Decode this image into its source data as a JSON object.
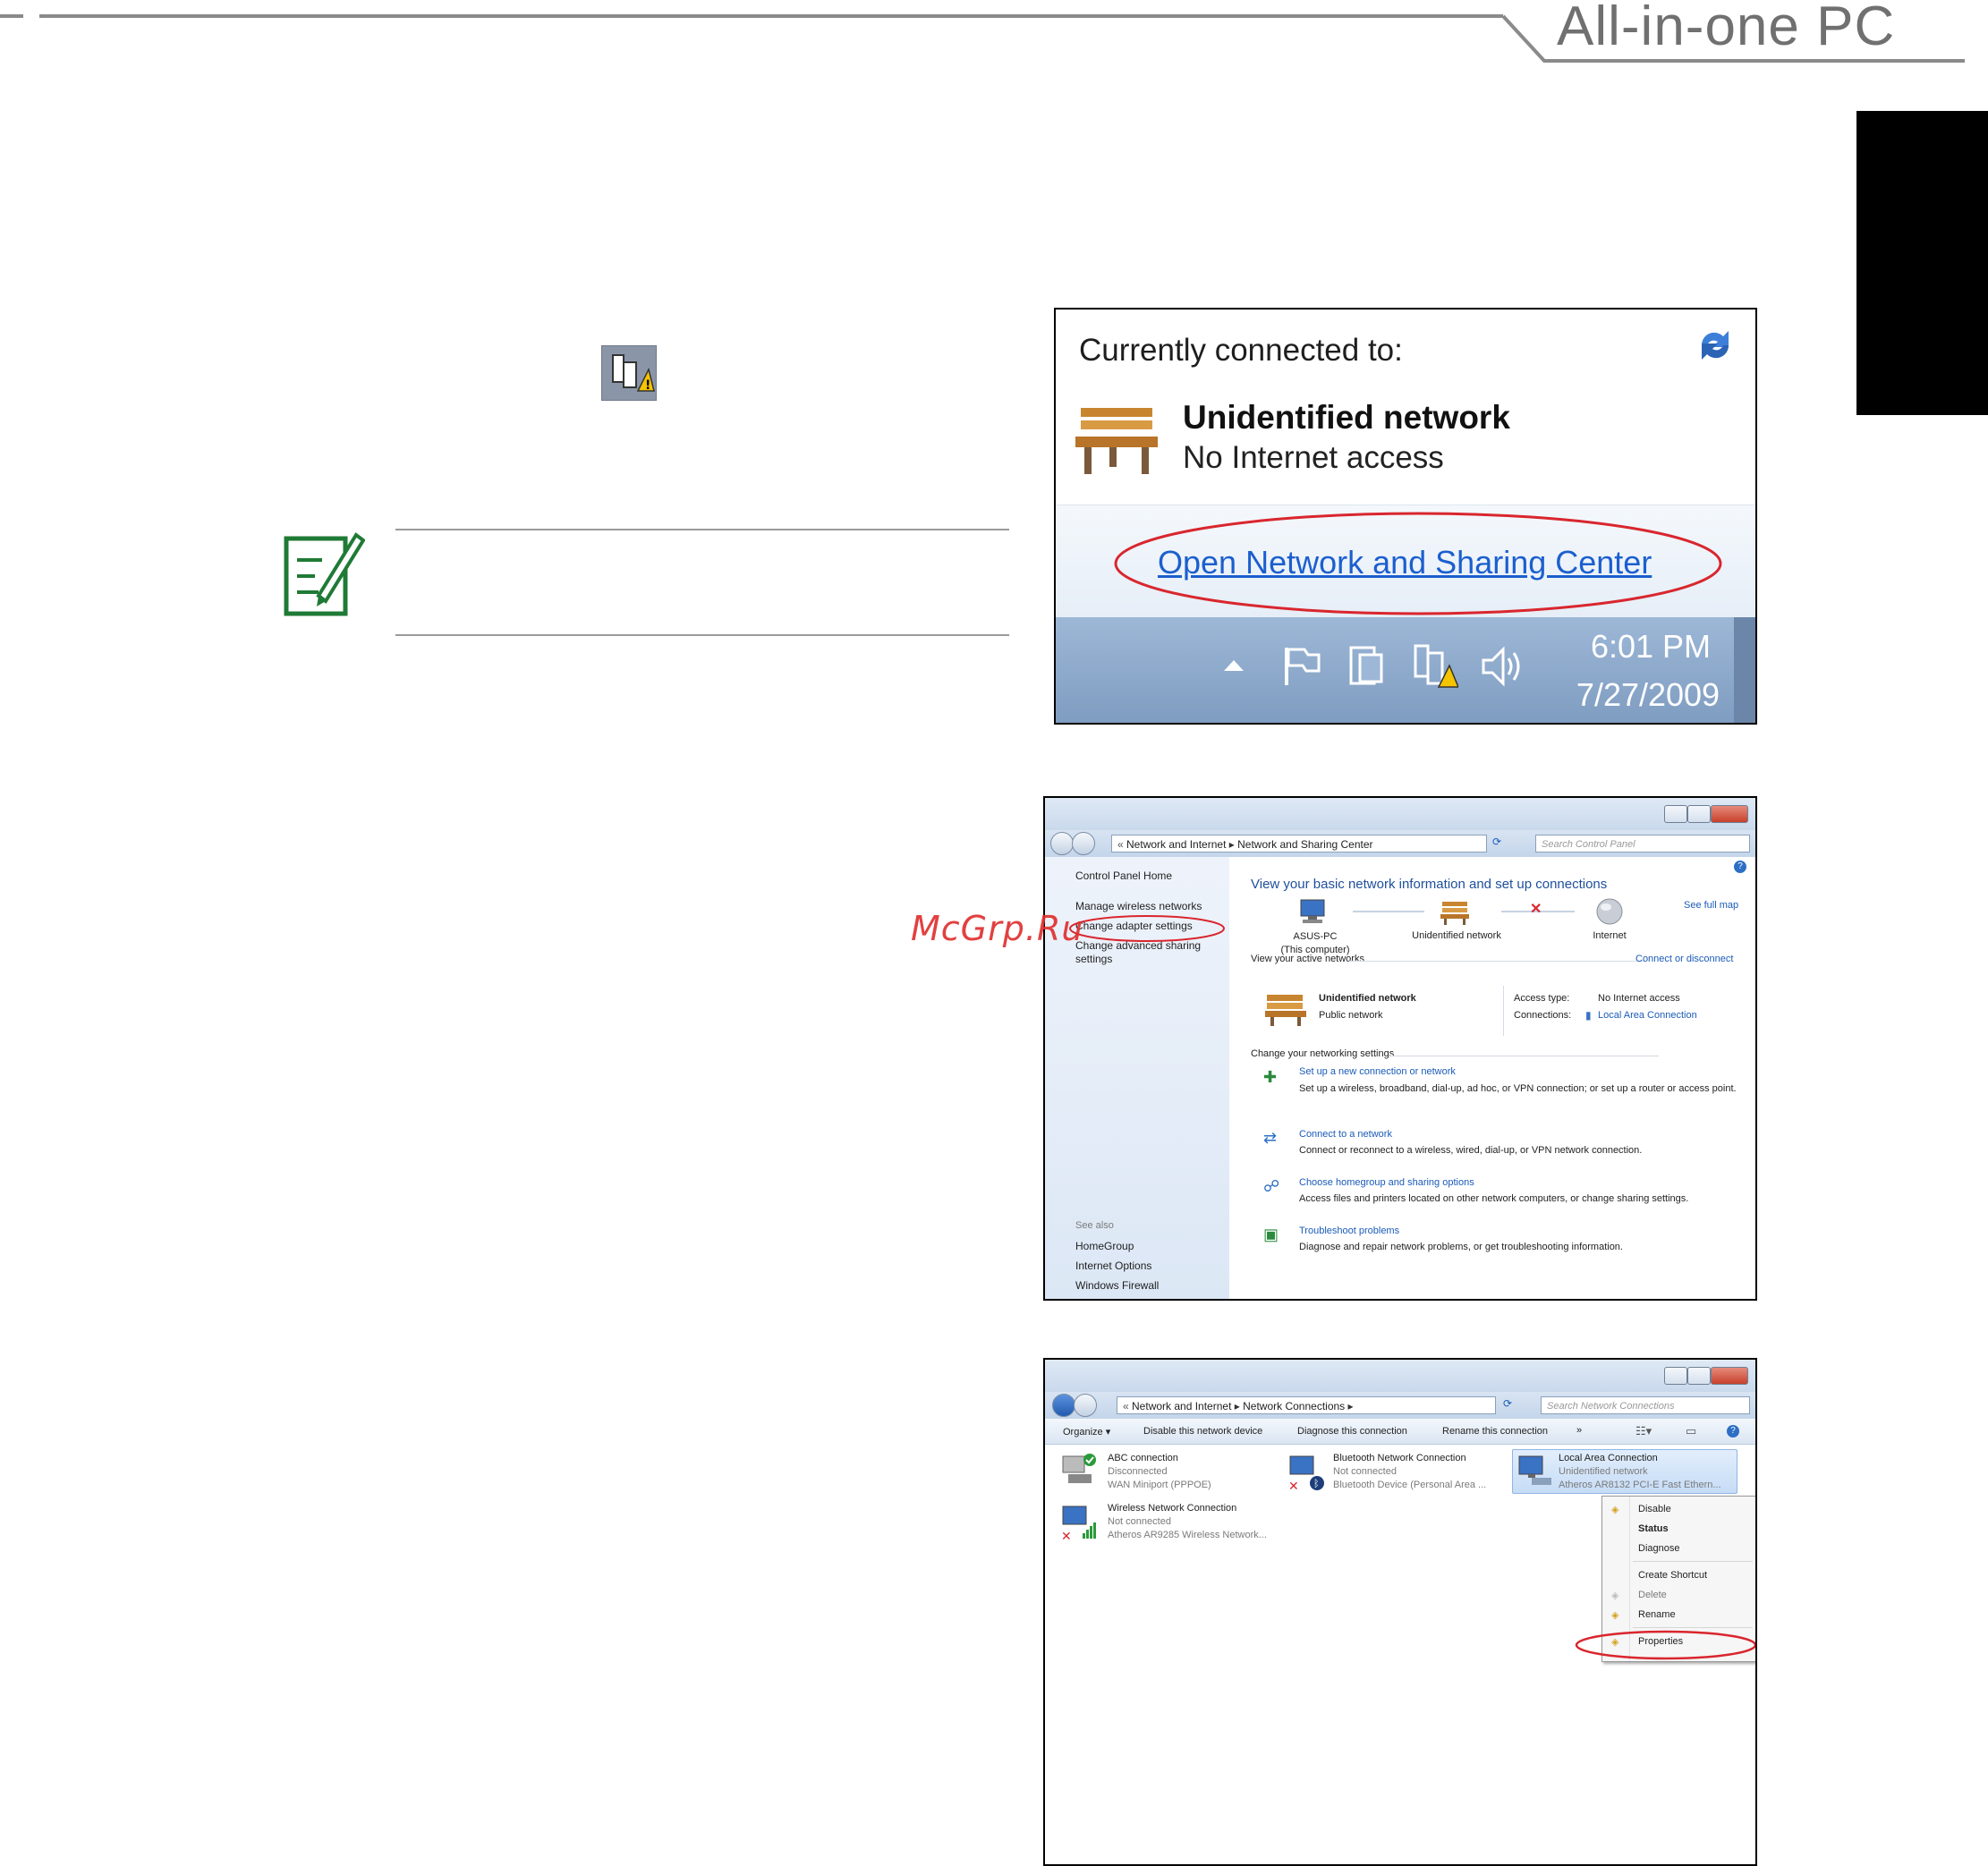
{
  "header": {
    "title": "All-in-one PC"
  },
  "popup": {
    "title": "Currently connected to:",
    "network_name": "Unidentified network",
    "network_status": "No Internet access",
    "link": "Open Network and Sharing Center",
    "time": "6:01 PM",
    "date": "7/27/2009"
  },
  "nsc": {
    "breadcrumb": [
      "Network and Internet",
      "Network and Sharing Center"
    ],
    "search_placeholder": "Search Control Panel",
    "sidebar": {
      "home": "Control Panel Home",
      "items": [
        "Manage wireless networks",
        "Change adapter settings",
        "Change advanced sharing settings"
      ],
      "see_also_label": "See also",
      "see_also": [
        "HomeGroup",
        "Internet Options",
        "Windows Firewall"
      ]
    },
    "main_title": "View your basic network information and set up connections",
    "see_full_map": "See full map",
    "map": {
      "computer": "ASUS-PC",
      "computer_sub": "(This computer)",
      "network": "Unidentified network",
      "internet": "Internet"
    },
    "active_label": "View your active networks",
    "connect_disconnect": "Connect or disconnect",
    "active": {
      "name": "Unidentified network",
      "type": "Public network",
      "access_label": "Access type:",
      "access_value": "No Internet access",
      "conn_label": "Connections:",
      "conn_value": "Local Area Connection"
    },
    "change_label": "Change your networking settings",
    "tasks": [
      {
        "title": "Set up a new connection or network",
        "desc": "Set up a wireless, broadband, dial-up, ad hoc, or VPN connection; or set up a router or access point."
      },
      {
        "title": "Connect to a network",
        "desc": "Connect or reconnect to a wireless, wired, dial-up, or VPN network connection."
      },
      {
        "title": "Choose homegroup and sharing options",
        "desc": "Access files and printers located on other network computers, or change sharing settings."
      },
      {
        "title": "Troubleshoot problems",
        "desc": "Diagnose and repair network problems, or get troubleshooting information."
      }
    ]
  },
  "ncw": {
    "breadcrumb": [
      "Network and Internet",
      "Network Connections"
    ],
    "search_placeholder": "Search Network Connections",
    "toolbar": [
      "Organize ▾",
      "Disable this network device",
      "Diagnose this connection",
      "Rename this connection",
      "»"
    ],
    "connections": [
      {
        "name": "ABC connection",
        "status": "Disconnected",
        "device": "WAN Miniport (PPPOE)"
      },
      {
        "name": "Bluetooth Network Connection",
        "status": "Not connected",
        "device": "Bluetooth Device (Personal Area ..."
      },
      {
        "name": "Local Area Connection",
        "status": "Unidentified network",
        "device": "Atheros AR8132 PCI-E Fast Ethern..."
      },
      {
        "name": "Wireless Network Connection",
        "status": "Not connected",
        "device": "Atheros AR9285 Wireless Network..."
      }
    ],
    "menu": [
      "Disable",
      "Status",
      "Diagnose",
      "Create Shortcut",
      "Delete",
      "Rename",
      "Properties"
    ]
  },
  "watermark": "McGrp.Ru",
  "colors": {
    "accent_red": "#d9262e",
    "link_blue": "#1a5bb8",
    "note_green": "#1f7a35"
  }
}
